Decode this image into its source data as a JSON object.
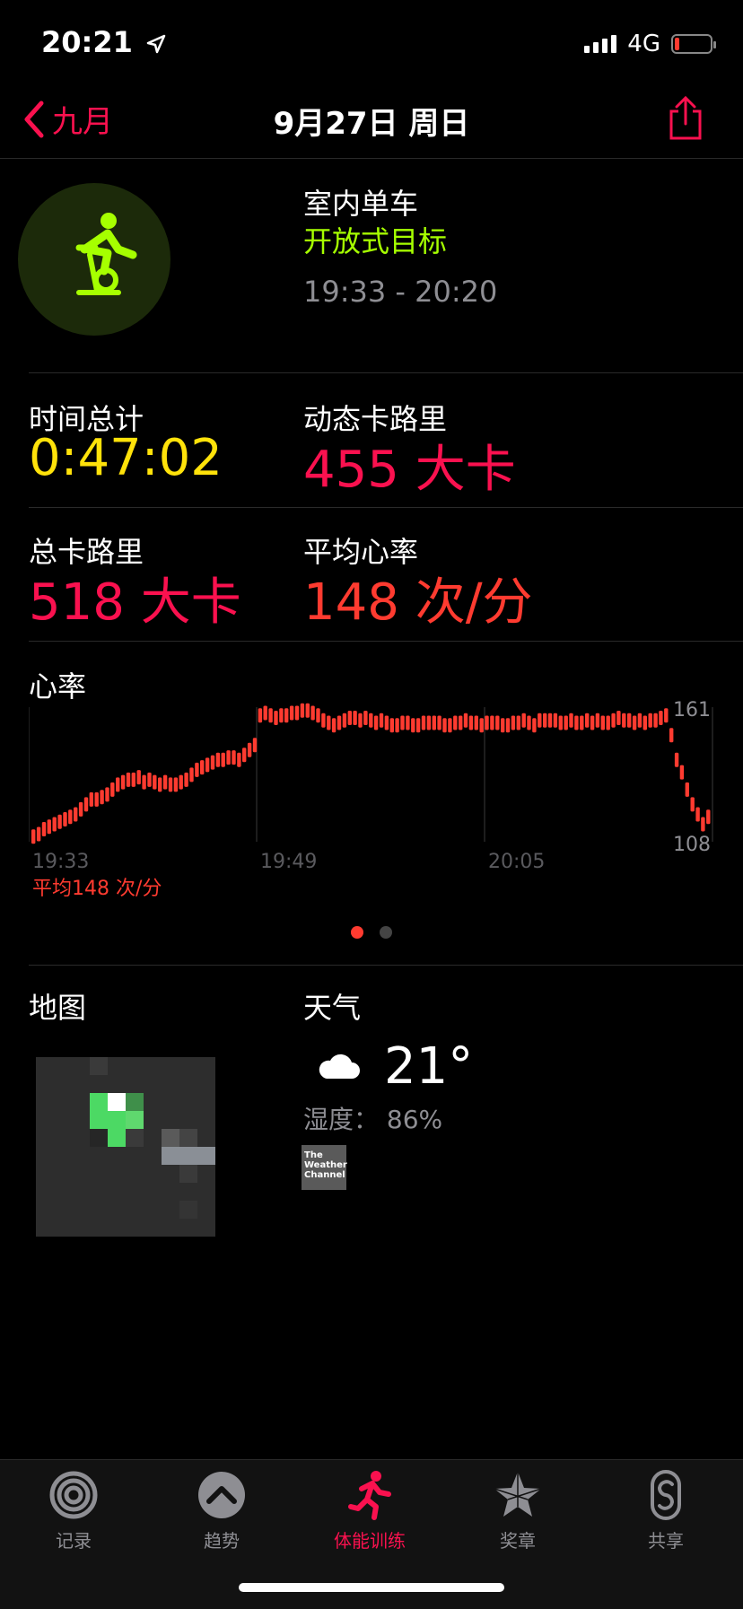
{
  "status": {
    "time": "20:21",
    "network": "4G"
  },
  "nav": {
    "back_label": "九月",
    "title": "9月27日 周日"
  },
  "workout": {
    "name": "室内单车",
    "goal": "开放式目标",
    "range": "19:33 - 20:20"
  },
  "metrics": {
    "total_time_label": "时间总计",
    "total_time": "0:47:02",
    "active_cal_label": "动态卡路里",
    "active_cal": "455 大卡",
    "total_cal_label": "总卡路里",
    "total_cal": "518 大卡",
    "avg_hr_label": "平均心率",
    "avg_hr": "148 次/分"
  },
  "heart_rate": {
    "title": "心率",
    "avg_label": "平均148 次/分",
    "chart_data": {
      "type": "bar",
      "x_ticks": [
        "19:33",
        "19:49",
        "20:05"
      ],
      "ylim": [
        108,
        161
      ],
      "y_labels": [
        "161",
        "108"
      ],
      "values": [
        109,
        110,
        112,
        113,
        114,
        115,
        116,
        117,
        118,
        120,
        122,
        124,
        124,
        125,
        126,
        128,
        130,
        131,
        132,
        132,
        133,
        131,
        132,
        131,
        130,
        131,
        130,
        130,
        131,
        132,
        134,
        136,
        137,
        138,
        139,
        140,
        140,
        141,
        141,
        140,
        142,
        144,
        146,
        158,
        159,
        158,
        157,
        158,
        158,
        159,
        159,
        160,
        160,
        159,
        158,
        156,
        155,
        154,
        155,
        156,
        157,
        157,
        156,
        157,
        156,
        155,
        156,
        155,
        154,
        154,
        155,
        155,
        154,
        154,
        155,
        155,
        155,
        155,
        154,
        154,
        155,
        155,
        156,
        155,
        155,
        154,
        155,
        155,
        155,
        154,
        154,
        155,
        155,
        156,
        155,
        154,
        156,
        156,
        156,
        156,
        155,
        155,
        156,
        155,
        155,
        156,
        155,
        156,
        155,
        155,
        156,
        157,
        156,
        156,
        155,
        156,
        155,
        156,
        156,
        157,
        158,
        150,
        140,
        135,
        128,
        122,
        118,
        114,
        117
      ]
    }
  },
  "pager": {
    "count": 2,
    "active": 0
  },
  "map": {
    "title": "地图"
  },
  "weather": {
    "title": "天气",
    "temp": "21°",
    "humidity": "湿度： 86%",
    "provider": "The Weather Channel"
  },
  "tabs": [
    {
      "label": "记录",
      "icon": "activity-rings-icon"
    },
    {
      "label": "趋势",
      "icon": "trends-icon"
    },
    {
      "label": "体能训练",
      "icon": "workout-runner-icon"
    },
    {
      "label": "奖章",
      "icon": "awards-star-icon"
    },
    {
      "label": "共享",
      "icon": "sharing-icon"
    }
  ]
}
